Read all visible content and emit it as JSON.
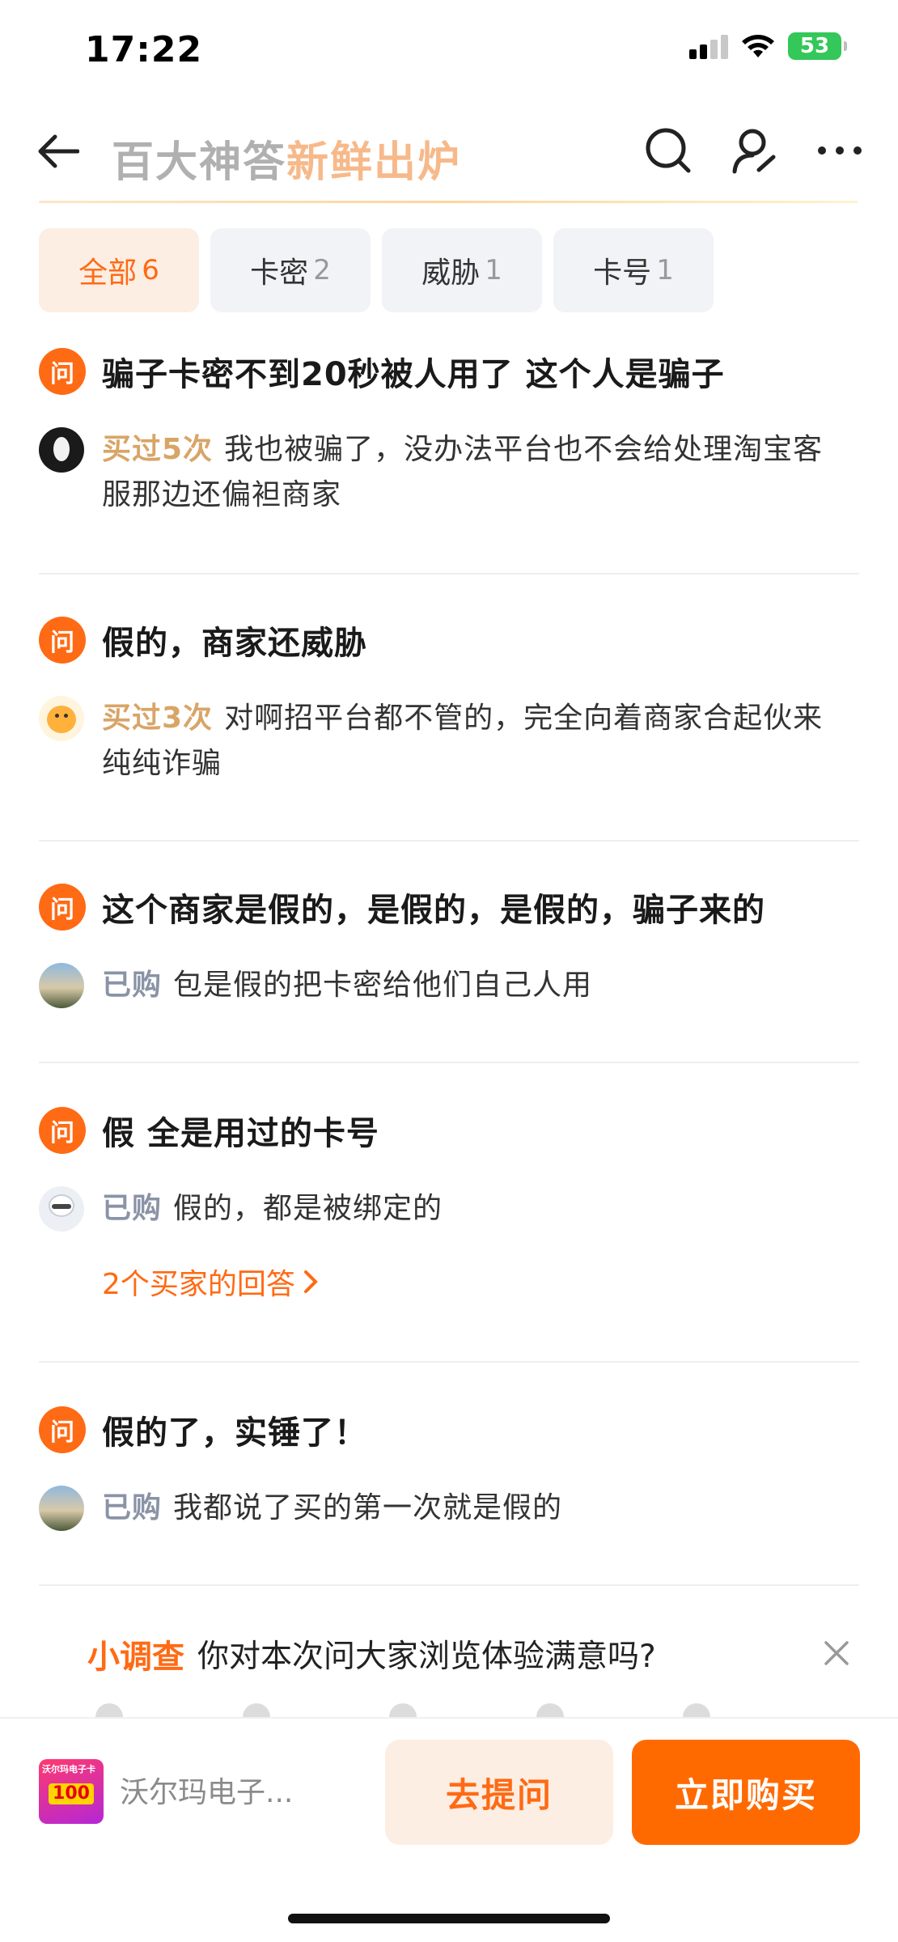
{
  "status_bar": {
    "time": "17:22",
    "battery": "53"
  },
  "header": {
    "title_part1": "百大神答",
    "title_part2": "新鲜出炉"
  },
  "tabs": [
    {
      "label": "全部",
      "count": "6"
    },
    {
      "label": "卡密",
      "count": "2"
    },
    {
      "label": "威胁",
      "count": "1"
    },
    {
      "label": "卡号",
      "count": "1"
    }
  ],
  "question_badge": "问",
  "questions": [
    {
      "question": "骗子卡密不到20秒被人用了 这个人是骗子",
      "answer_tag": "买过5次",
      "answer": "我也被骗了，没办法平台也不会给处理淘宝客",
      "answer_line2": "服那边还偏袒商家"
    },
    {
      "question": "假的，商家还威胁",
      "answer_tag": "买过3次",
      "answer": "对啊招平台都不管的，完全向着商家合起伙来",
      "answer_line2": "纯纯诈骗"
    },
    {
      "question": "这个商家是假的，是假的，是假的，骗子来的",
      "answer_tag": "已购",
      "answer": "包是假的把卡密给他们自己人用"
    },
    {
      "question": "假 全是用过的卡号",
      "answer_tag": "已购",
      "answer": "假的，都是被绑定的",
      "more_link": "2个买家的回答"
    },
    {
      "question": "假的了，实锤了！",
      "answer_tag": "已购",
      "answer": "我都说了买的第一次就是假的"
    }
  ],
  "survey": {
    "tag": "小调查",
    "text": "你对本次问大家浏览体验满意吗?"
  },
  "bottom_bar": {
    "product_name": "沃尔玛电子...",
    "product_thumb_label": "沃尔玛电子卡",
    "product_thumb_value": "100",
    "ask_label": "去提问",
    "buy_label": "立即购买"
  }
}
